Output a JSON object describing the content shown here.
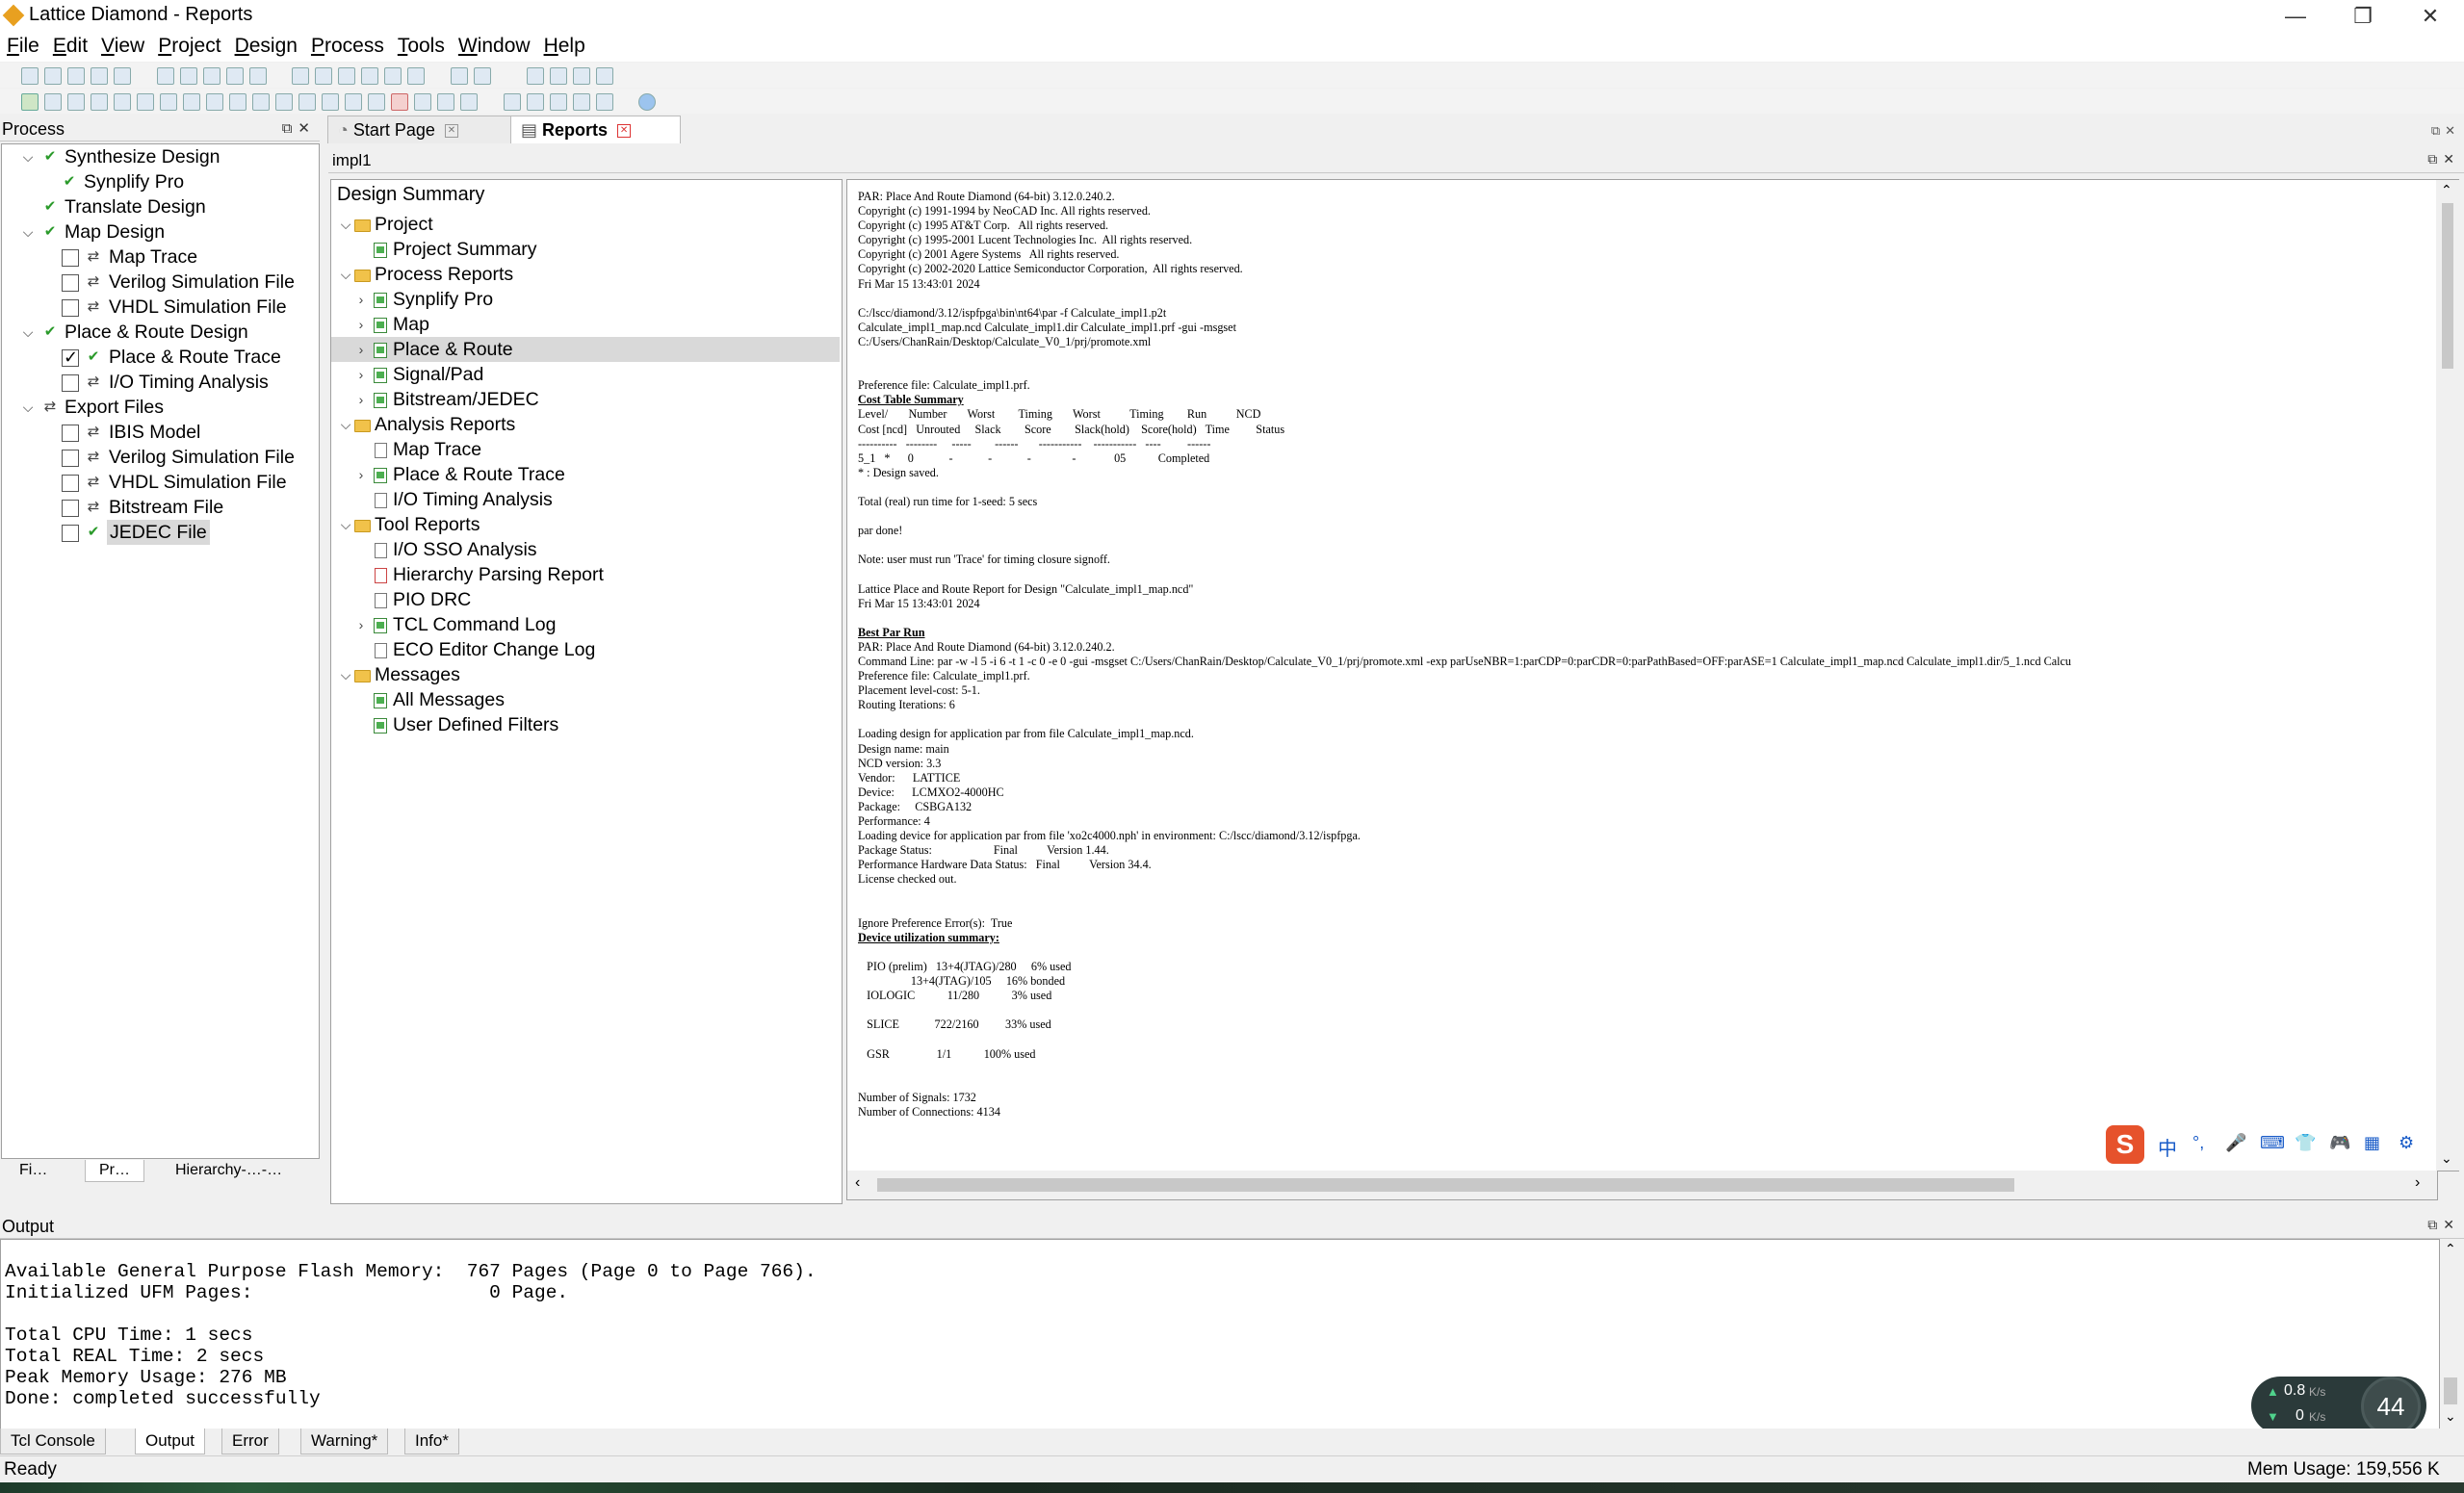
{
  "window": {
    "title": "Lattice Diamond - Reports",
    "controls": [
      "—",
      "❐",
      "✕"
    ]
  },
  "menu": [
    "File",
    "Edit",
    "View",
    "Project",
    "Design",
    "Process",
    "Tools",
    "Window",
    "Help"
  ],
  "process_panel": {
    "title": "Process",
    "items": [
      {
        "label": "Synthesize Design"
      },
      {
        "label": "Synplify Pro"
      },
      {
        "label": "Translate Design"
      },
      {
        "label": "Map Design"
      },
      {
        "label": "Map Trace"
      },
      {
        "label": "Verilog Simulation File"
      },
      {
        "label": "VHDL Simulation File"
      },
      {
        "label": "Place & Route Design"
      },
      {
        "label": "Place & Route Trace"
      },
      {
        "label": "I/O Timing Analysis"
      },
      {
        "label": "Export Files"
      },
      {
        "label": "IBIS Model"
      },
      {
        "label": "Verilog Simulation File"
      },
      {
        "label": "VHDL Simulation File"
      },
      {
        "label": "Bitstream File"
      },
      {
        "label": "JEDEC File"
      }
    ],
    "bottom_tabs": [
      "Fi…",
      "Pr…",
      "Hierarchy-…-…"
    ]
  },
  "doc_tabs": [
    {
      "label": "Start Page"
    },
    {
      "label": "Reports"
    }
  ],
  "impl_label": "impl1",
  "summary_tree": {
    "title": "Design Summary",
    "items": [
      {
        "label": "Project"
      },
      {
        "label": "Project Summary"
      },
      {
        "label": "Process Reports"
      },
      {
        "label": "Synplify Pro"
      },
      {
        "label": "Map"
      },
      {
        "label": "Place & Route"
      },
      {
        "label": "Signal/Pad"
      },
      {
        "label": "Bitstream/JEDEC"
      },
      {
        "label": "Analysis Reports"
      },
      {
        "label": "Map Trace"
      },
      {
        "label": "Place & Route Trace"
      },
      {
        "label": "I/O Timing Analysis"
      },
      {
        "label": "Tool Reports"
      },
      {
        "label": "I/O SSO Analysis"
      },
      {
        "label": "Hierarchy Parsing Report"
      },
      {
        "label": "PIO DRC"
      },
      {
        "label": "TCL Command Log"
      },
      {
        "label": "ECO Editor Change Log"
      },
      {
        "label": "Messages"
      },
      {
        "label": "All Messages"
      },
      {
        "label": "User Defined Filters"
      }
    ]
  },
  "report": {
    "block1": "PAR: Place And Route Diamond (64-bit) 3.12.0.240.2.\nCopyright (c) 1991-1994 by NeoCAD Inc. All rights reserved.\nCopyright (c) 1995 AT&T Corp.   All rights reserved.\nCopyright (c) 1995-2001 Lucent Technologies Inc.  All rights reserved.\nCopyright (c) 2001 Agere Systems   All rights reserved.\nCopyright (c) 2002-2020 Lattice Semiconductor Corporation,  All rights reserved.\nFri Mar 15 13:43:01 2024\n\nC:/lscc/diamond/3.12/ispfpga\\bin\\nt64\\par -f Calculate_impl1.p2t\nCalculate_impl1_map.ncd Calculate_impl1.dir Calculate_impl1.prf -gui -msgset\nC:/Users/ChanRain/Desktop/Calculate_V0_1/prj/promote.xml\n\n\nPreference file: Calculate_impl1.prf.\n",
    "head_cost": "Cost Table Summary",
    "block2": "Level/       Number       Worst        Timing       Worst          Timing        Run          NCD\nCost [ncd]   Unrouted     Slack        Score        Slack(hold)    Score(hold)   Time         Status\n----------   --------     -----        ------       -----------    -----------   ----         ------\n5_1   *      0            -            -            -              -             05           Completed\n* : Design saved.\n\nTotal (real) run time for 1-seed: 5 secs\n\npar done!\n\nNote: user must run 'Trace' for timing closure signoff.\n\nLattice Place and Route Report for Design \"Calculate_impl1_map.ncd\"\nFri Mar 15 13:43:01 2024\n\n",
    "head_best": "Best Par Run",
    "block3": "PAR: Place And Route Diamond (64-bit) 3.12.0.240.2.\nCommand Line: par -w -l 5 -i 6 -t 1 -c 0 -e 0 -gui -msgset C:/Users/ChanRain/Desktop/Calculate_V0_1/prj/promote.xml -exp parUseNBR=1:parCDP=0:parCDR=0:parPathBased=OFF:parASE=1 Calculate_impl1_map.ncd Calculate_impl1.dir/5_1.ncd Calcu\nPreference file: Calculate_impl1.prf.\nPlacement level-cost: 5-1.\nRouting Iterations: 6\n\nLoading design for application par from file Calculate_impl1_map.ncd.\nDesign name: main\nNCD version: 3.3\nVendor:      LATTICE\nDevice:      LCMXO2-4000HC\nPackage:     CSBGA132\nPerformance: 4\nLoading device for application par from file 'xo2c4000.nph' in environment: C:/lscc/diamond/3.12/ispfpga.\nPackage Status:                     Final          Version 1.44.\nPerformance Hardware Data Status:   Final          Version 34.4.\nLicense checked out.\n\n\nIgnore Preference Error(s):  True\n",
    "head_util": "Device utilization summary:",
    "block4": "\n   PIO (prelim)   13+4(JTAG)/280     6% used\n                  13+4(JTAG)/105     16% bonded\n   IOLOGIC           11/280           3% used\n\n   SLICE            722/2160         33% used\n\n   GSR                1/1           100% used\n\n\nNumber of Signals: 1732\nNumber of Connections: 4134"
  },
  "output_panel": {
    "title": "Output",
    "text": "\nAvailable General Purpose Flash Memory:  767 Pages (Page 0 to Page 766).\nInitialized UFM Pages:                     0 Page.\n\nTotal CPU Time: 1 secs\nTotal REAL Time: 2 secs\nPeak Memory Usage: 276 MB\nDone: completed successfully",
    "tabs": [
      "Tcl Console",
      "Output",
      "Error",
      "Warning*",
      "Info*"
    ]
  },
  "ime_toolbar": {
    "items": [
      "中",
      "°,",
      "🎤",
      "⌨",
      "👕",
      "🎮",
      "▦",
      "⚙"
    ]
  },
  "net_widget": {
    "up": "0.8",
    "down": "0",
    "unit": "K/s",
    "percent": "44"
  },
  "status": {
    "left": "Ready",
    "right": "Mem Usage: 159,556 K"
  }
}
